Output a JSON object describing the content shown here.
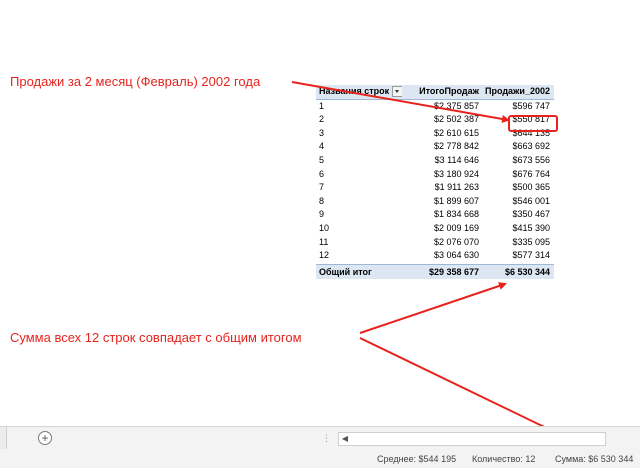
{
  "annotations": {
    "top": "Продажи за 2 месяц (Февраль) 2002 года",
    "bottom": "Сумма всех 12 строк совпадает с общим итогом"
  },
  "pivot": {
    "headers": {
      "rows": "Названия строк",
      "total": "ИтогоПродаж",
      "sales": "Продажи_2002"
    },
    "rows": [
      {
        "label": "1",
        "total": "$2 375 857",
        "sales": "$596 747"
      },
      {
        "label": "2",
        "total": "$2 502 387",
        "sales": "$550 817"
      },
      {
        "label": "3",
        "total": "$2 610 615",
        "sales": "$644 135"
      },
      {
        "label": "4",
        "total": "$2 778 842",
        "sales": "$663 692"
      },
      {
        "label": "5",
        "total": "$3 114 646",
        "sales": "$673 556"
      },
      {
        "label": "6",
        "total": "$3 180 924",
        "sales": "$676 764"
      },
      {
        "label": "7",
        "total": "$1 911 263",
        "sales": "$500 365"
      },
      {
        "label": "8",
        "total": "$1 899 607",
        "sales": "$546 001"
      },
      {
        "label": "9",
        "total": "$1 834 668",
        "sales": "$350 467"
      },
      {
        "label": "10",
        "total": "$2 009 169",
        "sales": "$415 390"
      },
      {
        "label": "11",
        "total": "$2 076 070",
        "sales": "$335 095"
      },
      {
        "label": "12",
        "total": "$3 064 630",
        "sales": "$577 314"
      }
    ],
    "grand_total": {
      "label": "Общий итог",
      "total": "$29 358 677",
      "sales": "$6 530 344"
    }
  },
  "status": {
    "average": "Среднее: $544 195",
    "count": "Количество: 12",
    "sum": "Сумма: $6 530 344"
  },
  "colors": {
    "accent_red": "#e8231e",
    "pivot_header_bg": "#dde7f3"
  }
}
